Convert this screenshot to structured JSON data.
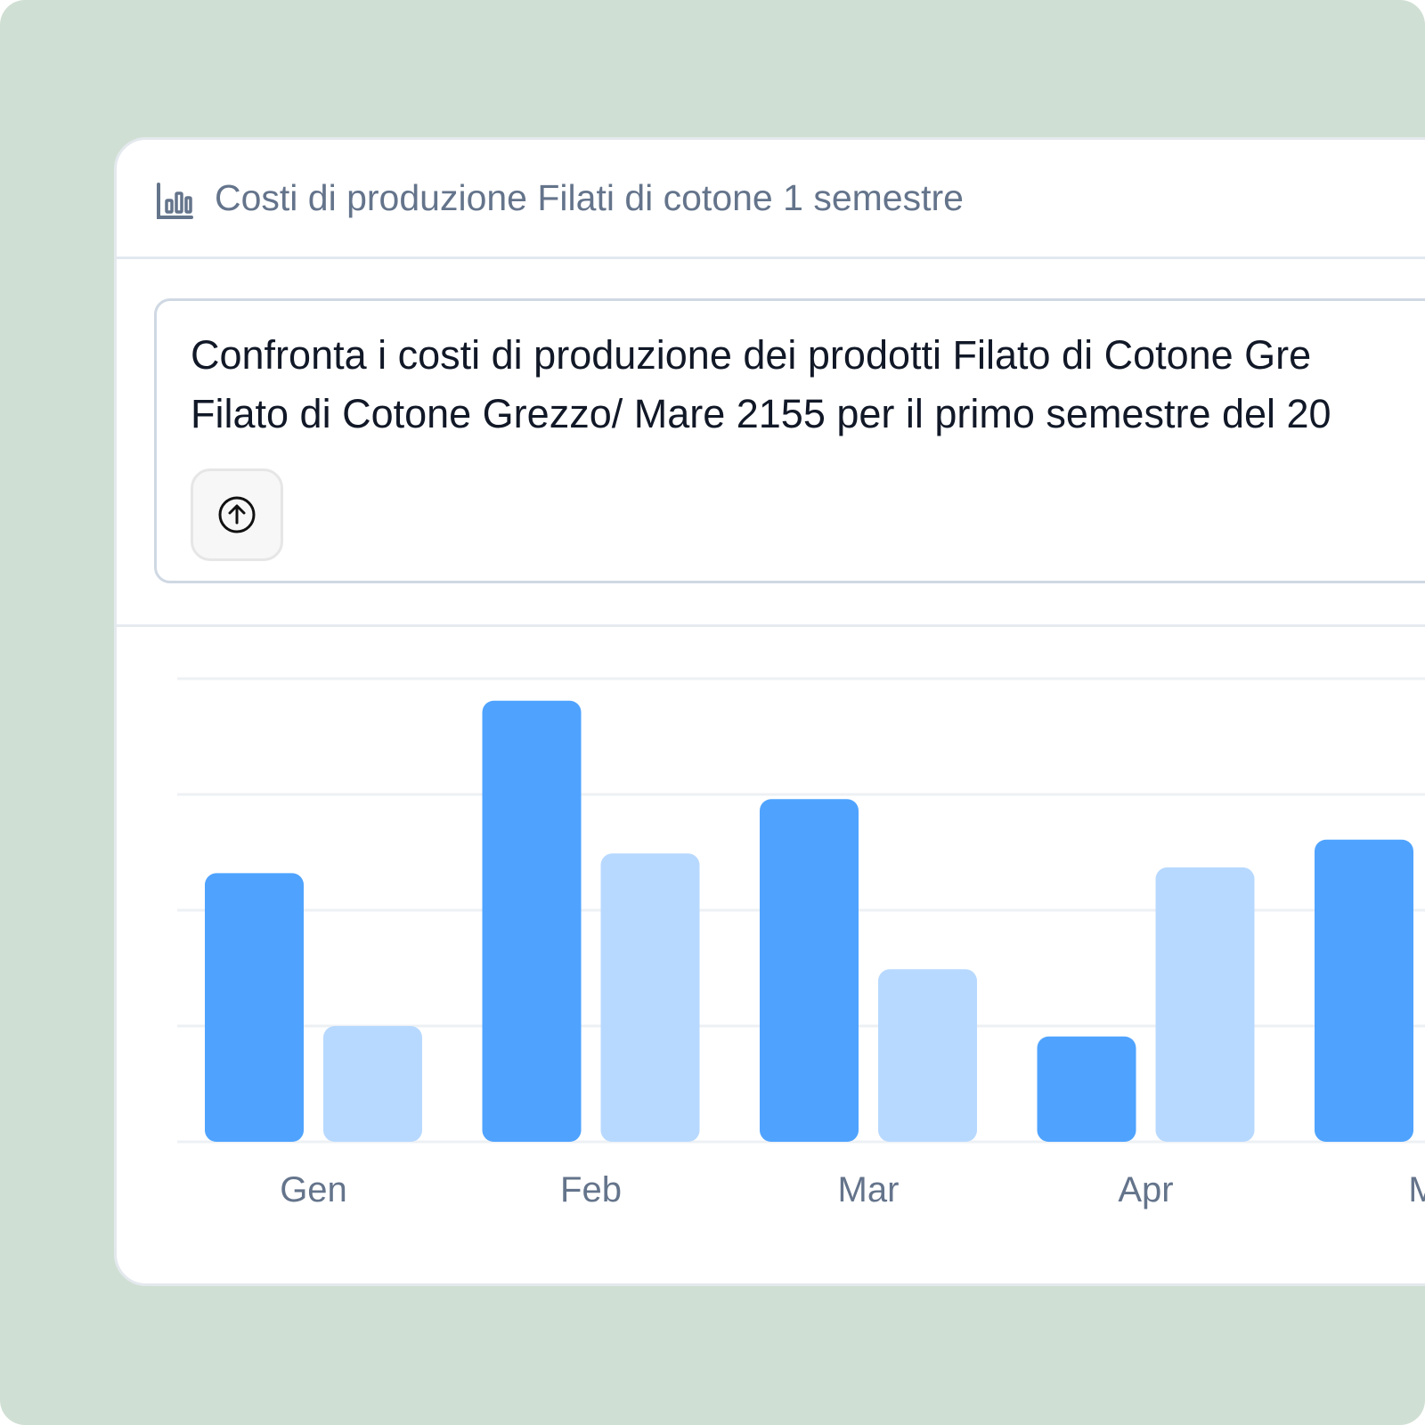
{
  "header": {
    "icon": "bar-chart-icon",
    "title": "Costi di produzione Filati di cotone 1 semestre"
  },
  "prompt": {
    "line1": "Confronta i costi di produzione dei prodotti Filato di Cotone Gre",
    "line2": "Filato di Cotone Grezzo/ Mare 2155 per il primo semestre del 20",
    "send_icon": "arrow-up-circle-icon"
  },
  "colors": {
    "series1": "#4fa3ff",
    "series2": "#b8d9ff",
    "background": "#d0dfd3"
  },
  "chart_data": {
    "type": "bar",
    "categories": [
      "Gen",
      "Feb",
      "Mar",
      "Apr",
      "M"
    ],
    "ylim": [
      0,
      4
    ],
    "grid": true,
    "series": [
      {
        "values": [
          2.32,
          3.81,
          2.96,
          0.91,
          2.61
        ]
      },
      {
        "values": [
          1.0,
          2.49,
          1.49,
          2.37,
          null
        ]
      }
    ]
  }
}
